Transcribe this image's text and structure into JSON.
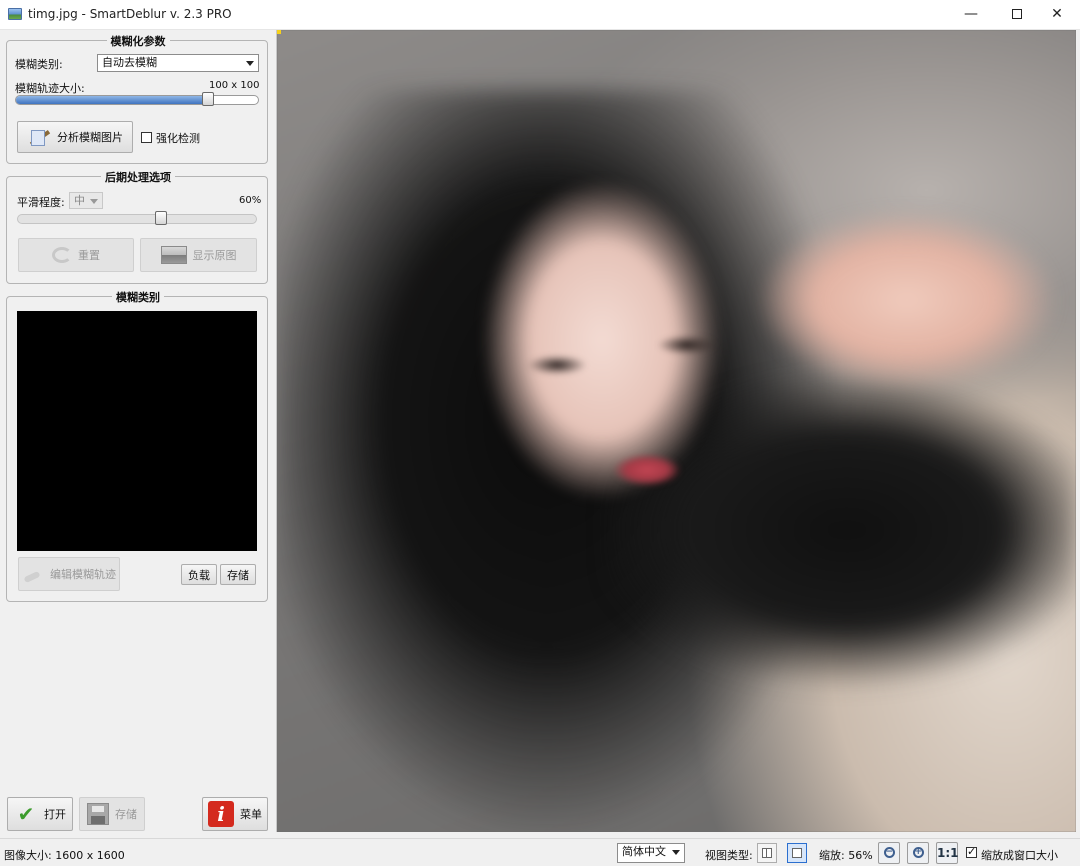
{
  "window": {
    "title": "timg.jpg - SmartDeblur v. 2.3 PRO",
    "minimize": "—",
    "close": "✕"
  },
  "blur_params": {
    "title": "模糊化参数",
    "type_label": "模糊类别:",
    "type_value": "自动去模糊",
    "trail_label": "模糊轨迹大小:",
    "trail_value": "100 x 100",
    "trail_slider_fraction": 0.79,
    "analyze_label": "分析模糊图片",
    "enhance_label": "强化检测",
    "enhance_checked": false
  },
  "post": {
    "title": "后期处理选项",
    "smooth_label": "平滑程度:",
    "smooth_value": "中",
    "smooth_percent": "60%",
    "smooth_slider_fraction": 0.6,
    "reset_label": "重置",
    "show_original_label": "显示原图"
  },
  "kernel": {
    "title": "模糊类别",
    "edit_label": "编辑模糊轨迹",
    "load_label": "负载",
    "save_label": "存储"
  },
  "bottom": {
    "open_label": "打开",
    "save_label": "存储",
    "menu_label": "菜单"
  },
  "status": {
    "image_size": "图像大小: 1600 x 1600",
    "language": "简体中文",
    "view_type_label": "视图类型:",
    "zoom_label": "缩放: 56%",
    "one_to_one": "1:1",
    "fit_window_label": "缩放成窗口大小",
    "fit_window_checked": true
  }
}
